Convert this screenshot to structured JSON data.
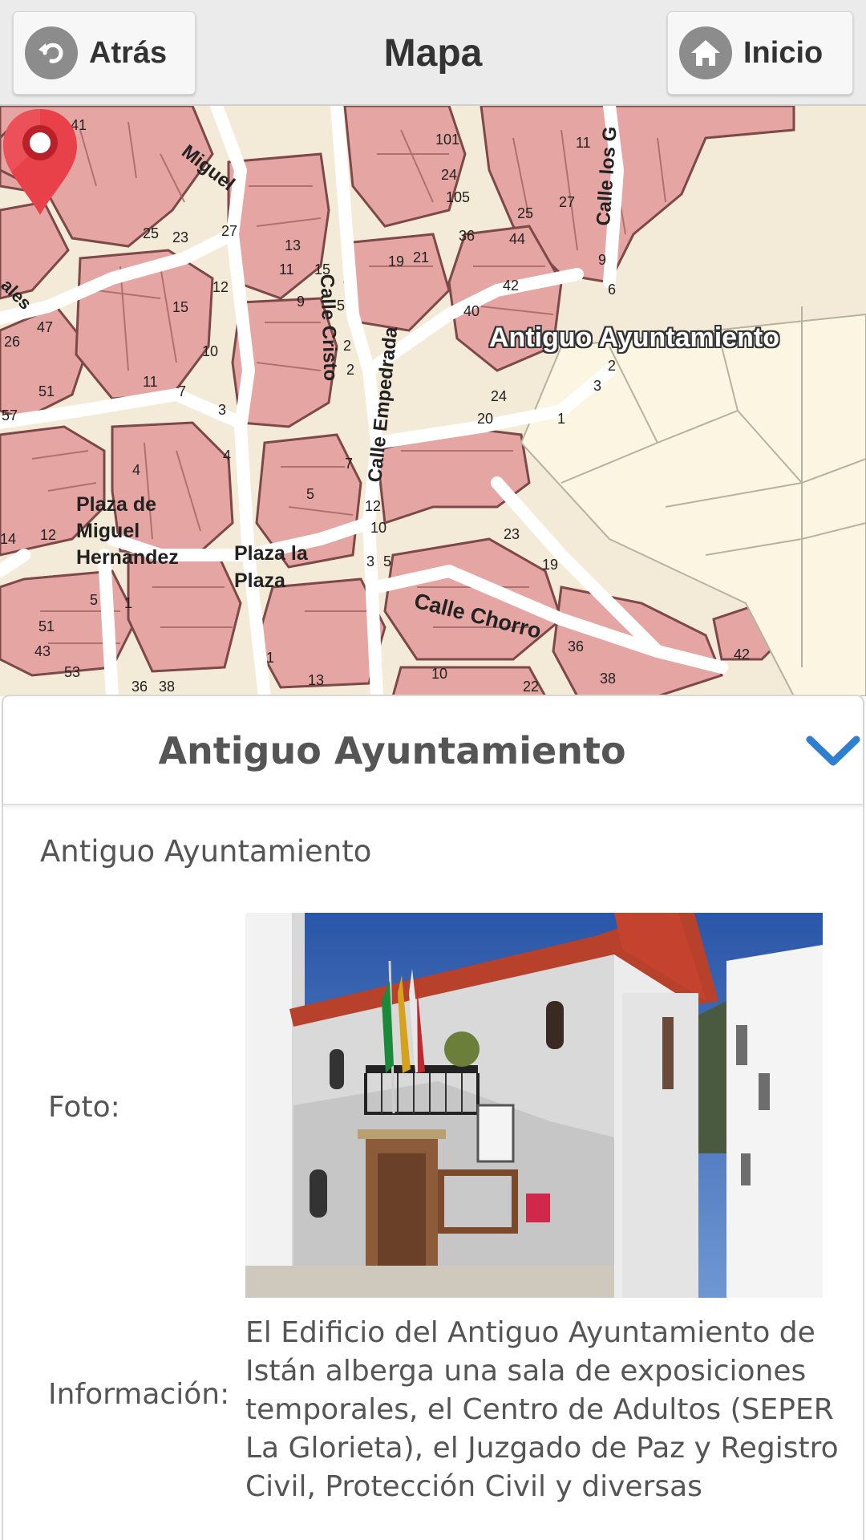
{
  "header": {
    "title": "Mapa",
    "back_label": "Atrás",
    "home_label": "Inicio",
    "back_icon": "back-arrow-icon",
    "home_icon": "home-icon"
  },
  "map": {
    "marker_label": "Antiguo Ayuntamiento",
    "marker_color": "#e8414a",
    "labels": {
      "plaza_miguel_1": "Plaza de",
      "plaza_miguel_2": "Miguel",
      "plaza_miguel_3": "Hernandez",
      "plaza_la_1": "Plaza la",
      "plaza_la_2": "Plaza",
      "calle_chorro": "Calle Chorro",
      "calle_empedrada": "Calle Empedrada",
      "calle_cristo": "Calle Cristo",
      "calle_los": "Calle los G",
      "miguel": "Miguel",
      "ales": "ales"
    },
    "house_numbers": [
      "41",
      "25",
      "23",
      "27",
      "13",
      "11",
      "15",
      "12",
      "15",
      "10",
      "9",
      "5",
      "19",
      "21",
      "101",
      "24",
      "105",
      "25",
      "27",
      "36",
      "44",
      "11",
      "9",
      "6",
      "42",
      "40",
      "26",
      "47",
      "51",
      "57",
      "11",
      "7",
      "3",
      "4",
      "2",
      "2",
      "7",
      "4",
      "5",
      "12",
      "10",
      "3",
      "5",
      "20",
      "24",
      "1",
      "3",
      "2",
      "12",
      "14",
      "23",
      "19",
      "36",
      "42",
      "5",
      "1",
      "51",
      "43",
      "53",
      "36",
      "38",
      "1",
      "13",
      "10",
      "22",
      "38"
    ]
  },
  "panel": {
    "title": "Antiguo Ayuntamiento",
    "subtitle": "Antiguo Ayuntamiento",
    "photo_label": "Foto:",
    "info_label": "Información:",
    "info_text": "El Edificio del Antiguo Ayuntamiento de Istán alberga una sala de exposiciones temporales, el Centro de Adultos (SEPER La Glorieta), el Juzgado de Paz y Registro Civil, Protección Civil y diversas",
    "collapse_icon": "chevron-down-icon",
    "accent_color": "#2f7fd1"
  }
}
